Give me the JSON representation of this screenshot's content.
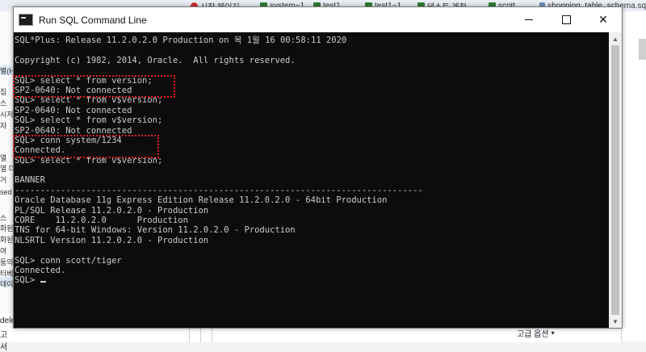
{
  "background": {
    "tabs": [
      {
        "label": "시작 페이지",
        "icon": "start-page-icon"
      },
      {
        "label": "system~1",
        "icon": "db-connection-icon"
      },
      {
        "label": "test1",
        "icon": "db-connection-icon"
      },
      {
        "label": "test1~1",
        "icon": "db-connection-icon"
      },
      {
        "label": "테스트 계정",
        "icon": "db-connection-icon"
      },
      {
        "label": "scott",
        "icon": "db-connection-icon"
      },
      {
        "label": "shopping_table_schema.sq",
        "icon": "sql-file-icon"
      }
    ],
    "left_fragments": [
      "별(H",
      "집",
      "스",
      "시저",
      "자",
      "열",
      "열 더",
      "거",
      "sed",
      "스",
      "화된",
      "화된",
      "여",
      "동의",
      "터베",
      "데이"
    ],
    "bottom_left": [
      "dele",
      "고서"
    ],
    "advanced_options": "고급 옵션"
  },
  "window": {
    "title": "Run SQL Command Line",
    "minimize": "minimize",
    "maximize": "maximize",
    "close": "✕"
  },
  "console": {
    "lines": [
      "SQL*Plus: Release 11.2.0.2.0 Production on 목 1월 16 00:58:11 2020",
      "",
      "Copyright (c) 1982, 2014, Oracle.  All rights reserved.",
      "",
      "SQL> select * from version;",
      "SP2-0640: Not connected",
      "SQL> select * from v$version;",
      "SP2-0640: Not connected",
      "SQL> select * from v$version;",
      "SP2-0640: Not connected",
      "SQL> conn system/1234",
      "Connected.",
      "SQL> select * from v$version;",
      "",
      "BANNER",
      "--------------------------------------------------------------------------------",
      "Oracle Database 11g Express Edition Release 11.2.0.2.0 - 64bit Production",
      "PL/SQL Release 11.2.0.2.0 - Production",
      "CORE    11.2.0.2.0      Production",
      "TNS for 64-bit Windows: Version 11.2.0.2.0 - Production",
      "NLSRTL Version 11.2.0.2.0 - Production",
      "",
      "SQL> conn scott/tiger",
      "Connected.",
      "SQL> "
    ]
  },
  "colors": {
    "console_bg": "#0c0c0c",
    "console_text": "#cccccc",
    "highlight": "#e02020"
  }
}
